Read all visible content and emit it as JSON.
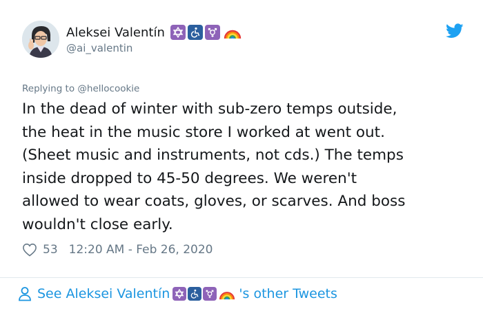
{
  "author": {
    "display_name": "Aleksei Valentín",
    "handle": "@ai_valentin",
    "badges": [
      "star-of-david-icon",
      "wheelchair-icon",
      "transgender-symbol-icon",
      "rainbow-icon"
    ]
  },
  "reply": {
    "prefix": "Replying to ",
    "mention": "@hellocookie"
  },
  "tweet": {
    "text": "In the dead of winter with sub-zero temps outside,\nthe heat in the music store I worked at went out.\n(Sheet music and instruments, not cds.) The temps\ninside dropped to 45-50 degrees. We weren't\nallowed to wear coats, gloves, or scarves. And boss\nwouldn't close early.",
    "likes": "53",
    "timestamp": "12:20 AM - Feb 26, 2020"
  },
  "footer": {
    "prefix": "See Aleksei Valentín",
    "suffix": "'s other Tweets"
  },
  "colors": {
    "text": "#14171a",
    "secondary": "#657786",
    "link": "#1b95e0",
    "twitter_blue": "#1da1f2",
    "badge_purple": "#8e63b8",
    "badge_blue": "#2b5f9e"
  },
  "icons": {
    "logo": "twitter-bird-icon",
    "like": "heart-outline-icon",
    "profile": "person-outline-icon"
  }
}
